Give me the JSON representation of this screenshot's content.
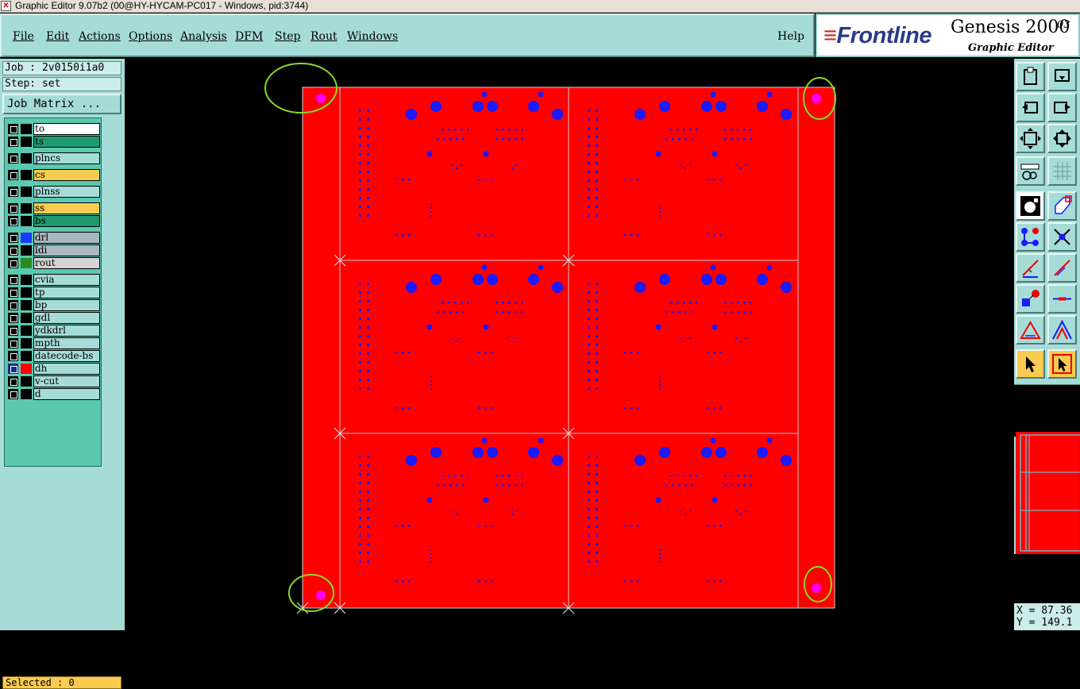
{
  "window": {
    "title": "Graphic Editor 9.07b2 (00@HY-HYCAM-PC017 - Windows, pid:3744)"
  },
  "menu": {
    "items": [
      {
        "label": "File"
      },
      {
        "label": "Edit"
      },
      {
        "label": "Actions"
      },
      {
        "label": "Options"
      },
      {
        "label": "Analysis"
      },
      {
        "label": "DFM"
      },
      {
        "label": "Step"
      },
      {
        "label": "Rout"
      },
      {
        "label": "Windows"
      }
    ],
    "help": "Help"
  },
  "logo": {
    "brand": "Frontline",
    "product": "Genesis 2000",
    "version": "03",
    "subtitle": "Graphic Editor"
  },
  "job": {
    "label": "Job : 2v0150i1a0",
    "step": "Step: set",
    "matrix_button": "Job Matrix ..."
  },
  "layers": [
    {
      "name": "to",
      "color": "#ffffff",
      "swatch": "#000000"
    },
    {
      "name": "ts",
      "color": "#1f9a6e",
      "swatch": "#000000"
    },
    {
      "name": "plncs",
      "color": "#a6dcd8",
      "swatch": "#000000"
    },
    {
      "name": "cs",
      "color": "#f8cc50",
      "swatch": "#000000"
    },
    {
      "name": "plnss",
      "color": "#a6dcd8",
      "swatch": "#000000"
    },
    {
      "name": "ss",
      "color": "#f8cc50",
      "swatch": "#000000"
    },
    {
      "name": "bs",
      "color": "#1f9a6e",
      "swatch": "#000000"
    },
    {
      "name": "drl",
      "color": "#a8b8c0",
      "swatch": "#1a3cff"
    },
    {
      "name": "ldi",
      "color": "#a8b8c0",
      "swatch": "#000000"
    },
    {
      "name": "rout",
      "color": "#d4d4d4",
      "swatch": "#2a8a20"
    },
    {
      "name": "cvia",
      "color": "#a6dcd8",
      "swatch": "#000000"
    },
    {
      "name": "tp",
      "color": "#a6dcd8",
      "swatch": "#000000"
    },
    {
      "name": "bp",
      "color": "#a6dcd8",
      "swatch": "#000000"
    },
    {
      "name": "gdl",
      "color": "#a6dcd8",
      "swatch": "#000000"
    },
    {
      "name": "ydkdrl",
      "color": "#a6dcd8",
      "swatch": "#000000"
    },
    {
      "name": "mpth",
      "color": "#a6dcd8",
      "swatch": "#000000"
    },
    {
      "name": "datecode-bs",
      "color": "#a6dcd8",
      "swatch": "#000000"
    },
    {
      "name": "dh",
      "color": "#a6dcd8",
      "swatch": "#ff0000",
      "active": true
    },
    {
      "name": "v-cut",
      "color": "#a6dcd8",
      "swatch": "#000000"
    },
    {
      "name": "d",
      "color": "#a6dcd8",
      "swatch": "#000000"
    }
  ],
  "status": {
    "selected": "Selected : 0"
  },
  "coords": {
    "x": "X = 87.36",
    "y": "Y = 149.1"
  },
  "colors": {
    "board": "#ff0000",
    "pad": "#1a1aff",
    "fiducial": "#ff00ff",
    "highlight": "#8ad82a",
    "panel_bg": "#a6dcd8"
  },
  "toolbar_icons": [
    "step-profile-icon",
    "zoom-home-icon",
    "pan-left-icon",
    "pan-right-icon",
    "zoom-fit-icon",
    "zoom-center-icon",
    "measure-icon",
    "grid-icon",
    "feature-select-icon",
    "add-line-icon",
    "netlist-icon",
    "delete-cross-icon",
    "line-angle-icon",
    "line-draw-icon",
    "pad-add-icon",
    "cut-line-icon",
    "polygon-icon",
    "mountain-icon",
    "select-arrow-icon",
    "select-box-icon"
  ]
}
